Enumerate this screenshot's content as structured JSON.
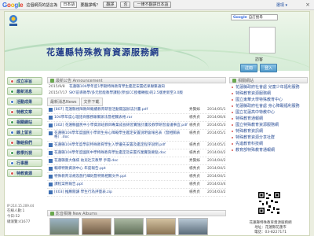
{
  "google_bar": {
    "logo": [
      "G",
      "o",
      "o",
      "g",
      "l",
      "e"
    ],
    "prompt": "這個網頁的語言為",
    "language": "日本語",
    "question": "要翻譯嗎？",
    "translate": "翻譯",
    "no": "否",
    "never": "一律不翻譯日本語",
    "options": "選項 ▾",
    "close": "×"
  },
  "header": {
    "site_title": "花蓮縣特殊教育資源服務網",
    "search_placeholder": "",
    "search_logo": "Google",
    "search_label": "自訂搜尋",
    "visitor": "訪客",
    "register": "註冊",
    "login": "登入"
  },
  "sidebar": {
    "items": [
      {
        "label": "成立宗旨",
        "color": "r"
      },
      {
        "label": "最新消息",
        "color": "g"
      },
      {
        "label": "活動成果",
        "color": "b"
      },
      {
        "label": "特教文章",
        "color": "r"
      },
      {
        "label": "相關網站",
        "color": "g"
      },
      {
        "label": "線上留言",
        "color": "b"
      },
      {
        "label": "聯絡我們",
        "color": "r"
      },
      {
        "label": "教學托視",
        "color": "g"
      },
      {
        "label": "行事曆",
        "color": "b"
      },
      {
        "label": "特教資源",
        "color": "r"
      }
    ],
    "ip": "IP:210.15.209.44",
    "online": "在線人數",
    "online_val": "1",
    "today": "今日:52",
    "total": "總瀏覽:41677"
  },
  "announcement": {
    "heading": "最新公告 Announcement",
    "rows": [
      {
        "date": "2015/9/8",
        "title": "花蓮縣104學年度1學期特殊教育學生鑑定安置結果聯繫通知",
        "unit": "",
        "posted": ""
      },
      {
        "date": "2015/7/17",
        "title": "SKY前導教學/多元智能教學課程(參加CC授權轉換)的2.5版更新至3.0版",
        "unit": "",
        "posted": ""
      }
    ]
  },
  "news": {
    "tabs": [
      "最新消息News",
      "文件下載"
    ],
    "rows": [
      {
        "title": "[807] 花蓮縣視障教師繼續教育研習活動開設辦法計畫.pdf",
        "unit": "秀賢姊",
        "date": "2014/05/1"
      },
      {
        "title": "104學年度心理諮商服務聯繫辦法暨相關表格.rar",
        "unit": "楊秀貞",
        "date": "2014/06/4"
      },
      {
        "title": "[302] 花蓮縣國民中小學資源班教師專業成長研習實施計畫及教學研習會議事宜.pdf",
        "unit": "楊秀貞",
        "date": "2014/05/3"
      },
      {
        "title": "花蓮縣104學年度國民小學新生身心障礙學生鑑定安置說明會報名表（暨相關表格）.doc",
        "unit": "楊秀貞",
        "date": "2014/05/1"
      },
      {
        "title": "花蓮縣104學年度學前特殊教育學生入學優先安置及鑑定程序說明.pdf",
        "unit": "楊秀貞",
        "date": "2014/05/1"
      },
      {
        "title": "花蓮縣104學年度國民中學特殊教育學生鑑定及安置作業實施要點.doc",
        "unit": "楊秀貞",
        "date": "2014/04/2"
      },
      {
        "title": "花蓮縣重大傷病 幼兒社交教學 手冊.doc",
        "unit": "秀賢姊",
        "date": "2014/04/2"
      },
      {
        "title": "輔導特教資源中心 年度報告.ppt",
        "unit": "楊秀貞",
        "date": "2014/04/1"
      },
      {
        "title": "特殊教育法規及施行細則暨特教相關文件.ppt",
        "unit": "楊秀貞",
        "date": "2014/04/1"
      },
      {
        "title": "課程案例報告.ppt",
        "unit": "楊秀貞",
        "date": "2014/03/4"
      },
      {
        "title": "[403] 推薦閱讀 學生行為評量表.zip",
        "unit": "楊秀貞",
        "date": "2014/03/2"
      }
    ]
  },
  "photos": {
    "heading": "影音相簿 New Albums"
  },
  "right": {
    "heading": "相關網站",
    "links": [
      "花蓮縣政府社會處 兒童少年福利服務",
      "特殊教育資源服務網",
      "國立東華大學特殊教育中心",
      "花蓮縣政府社會處 身心障礙福利服務",
      "國立花蓮高中特教中心",
      "特殊教育通報網",
      "國立特殊教育資源服務網",
      "特殊教育資訊網",
      "特殊教育資源分享社群",
      "先進教育科技網",
      "教育部特殊教育通報網"
    ]
  },
  "footer": {
    "line1": "花蓮縣特殊教育資源服務網",
    "line2": "地址：花蓮縣花蓮市",
    "line3": "電話：03-8227171"
  }
}
